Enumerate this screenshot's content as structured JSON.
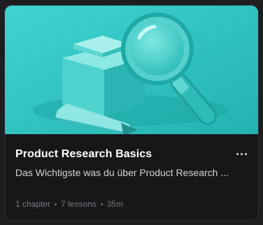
{
  "card": {
    "image_icon": "magnifier-box-illustration",
    "accent_color": "#2cc5c2",
    "title": "Product Research Basics",
    "description": "Das Wichtigste was du über Product Research ...",
    "more_icon": "more-horizontal-icon",
    "meta": {
      "chapters": "1 chapter",
      "lessons": "7 lessons",
      "duration": "35m"
    }
  }
}
